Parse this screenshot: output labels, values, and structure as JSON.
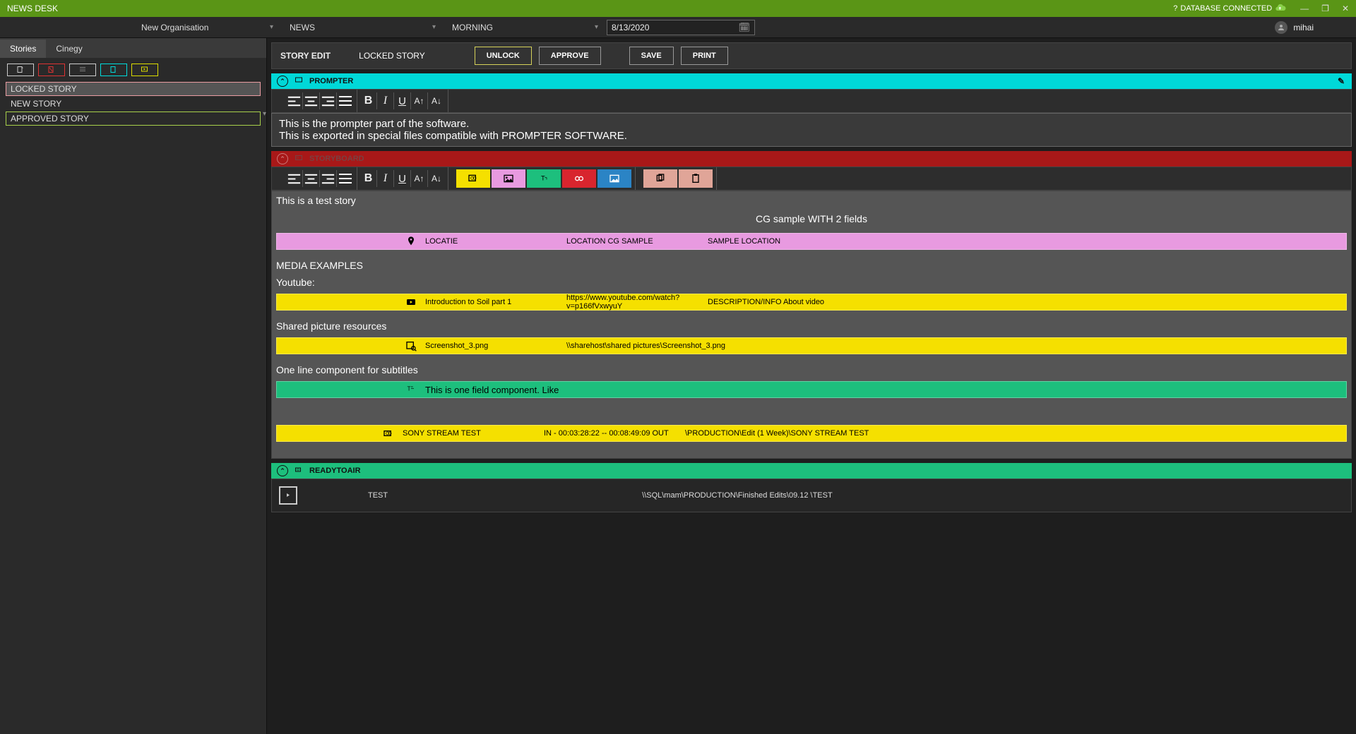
{
  "titlebar": {
    "title": "NEWS DESK",
    "db_status": "DATABASE CONNECTED",
    "help_q": "?"
  },
  "toolbar": {
    "org": "New Organisation",
    "news": "NEWS",
    "morning": "MORNING",
    "date": "8/13/2020",
    "user": "mihai"
  },
  "left": {
    "tabs": {
      "stories": "Stories",
      "cinegy": "Cinegy"
    },
    "stories": {
      "locked": "LOCKED STORY",
      "new": "NEW STORY",
      "approved": "APPROVED STORY"
    }
  },
  "editor": {
    "title": "STORY EDIT",
    "subtitle": "LOCKED STORY",
    "unlock": "UNLOCK",
    "approve": "APPROVE",
    "save": "SAVE",
    "print": "PRINT"
  },
  "prompter": {
    "header": "PROMPTER",
    "line1": "This is the prompter part of the software.",
    "line2": "This is exported in special files compatible with PROMPTER SOFTWARE."
  },
  "fmt": {
    "a_up": "A↑",
    "a_dn": "A↓"
  },
  "storyboard": {
    "header": "STORYBOARD",
    "intro": "This is a test story",
    "cg_title": "CG sample WITH 2 fields",
    "row_loc": {
      "c1": "LOCATIE",
      "c2": "LOCATION CG SAMPLE",
      "c3": "SAMPLE LOCATION"
    },
    "media_hdr": "MEDIA EXAMPLES",
    "youtube_lbl": "Youtube:",
    "row_yt": {
      "c1": "Introduction to Soil  part 1",
      "c2": "https://www.youtube.com/watch?v=p166fVxwyuY",
      "c3": "DESCRIPTION/INFO About video"
    },
    "shared_lbl": "Shared picture resources",
    "row_pic": {
      "c1": "Screenshot_3.png",
      "c2": "\\\\sharehost\\shared pictures\\Screenshot_3.png",
      "c3": ""
    },
    "sub_lbl": "One line component for subtitles",
    "row_sub": {
      "c1": "This is one field component. Like"
    },
    "row_sony": {
      "c1": "SONY STREAM TEST",
      "c2": "IN - 00:03:28:22 -- 00:08:49:09 OUT",
      "c3": "\\PRODUCTION\\Edit  (1 Week)\\SONY STREAM TEST"
    }
  },
  "rta": {
    "header": "READYTOAIR",
    "name": "TEST",
    "path": "\\\\SQL\\mam\\PRODUCTION\\Finished Edits\\09.12 \\TEST"
  }
}
